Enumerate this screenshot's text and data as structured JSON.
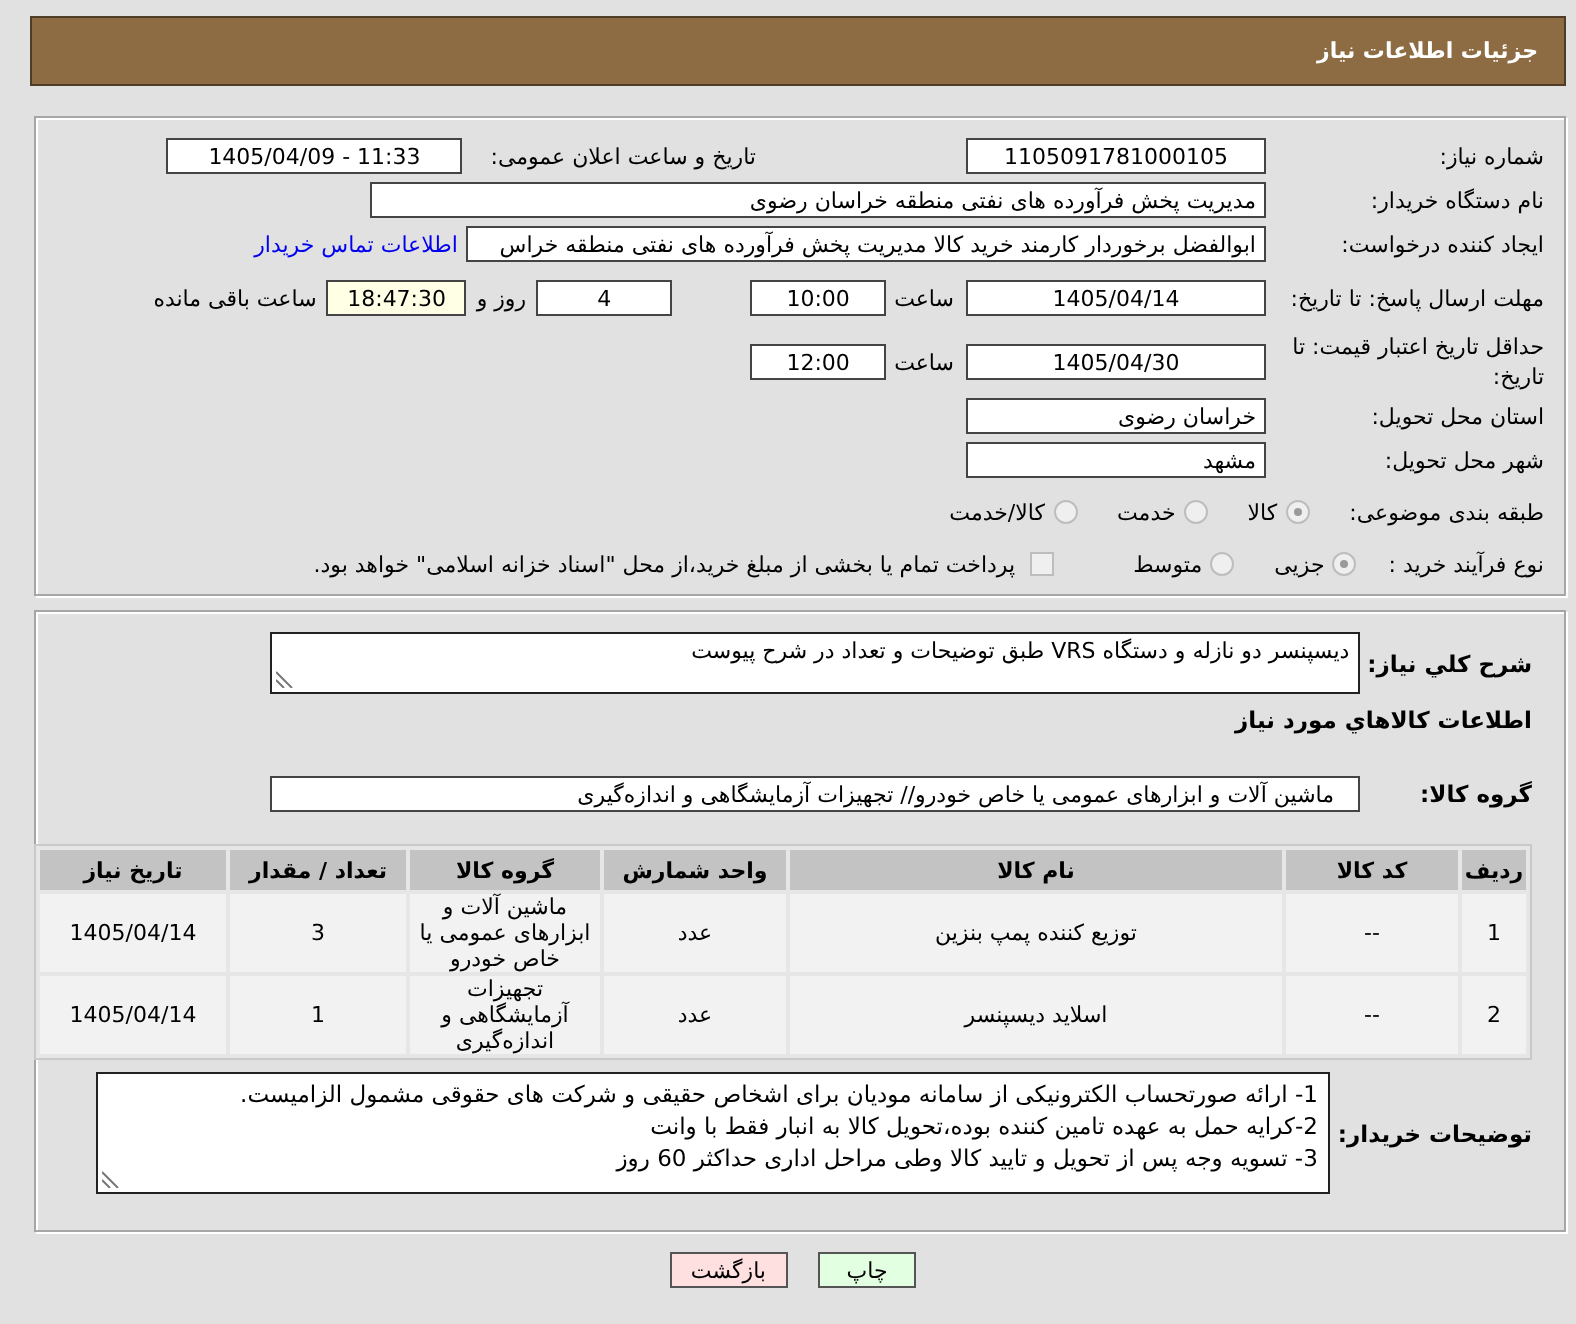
{
  "header": {
    "title": "جزئیات اطلاعات نیاز"
  },
  "details": {
    "need_number": {
      "label": "شماره نیاز:",
      "value": "1105091781000105"
    },
    "announce_datetime": {
      "label": "تاریخ و ساعت اعلان عمومی:",
      "value": "1405/04/09 - 11:33"
    },
    "buyer_org": {
      "label": "نام دستگاه خریدار:",
      "value": "مدیریت پخش فرآورده های نفتی منطقه خراسان رضوی"
    },
    "requester": {
      "label": "ایجاد کننده درخواست:",
      "value": "ابوالفضل برخوردار کارمند خرید کالا مدیریت پخش فرآورده های نفتی منطقه خراس",
      "contact_link": "اطلاعات تماس خریدار"
    },
    "reply_deadline": {
      "label": "مهلت ارسال پاسخ: تا تاریخ:",
      "date": "1405/04/14",
      "time_label": "ساعت",
      "time": "10:00",
      "days": "4",
      "days_label": "روز و",
      "remaining": "18:47:30",
      "remaining_label": "ساعت باقی مانده"
    },
    "price_validity": {
      "label": "حداقل تاریخ اعتبار قیمت: تا تاریخ:",
      "date": "1405/04/30",
      "time_label": "ساعت",
      "time": "12:00"
    },
    "delivery_province": {
      "label": "استان محل تحویل:",
      "value": "خراسان رضوی"
    },
    "delivery_city": {
      "label": "شهر محل تحویل:",
      "value": "مشهد"
    },
    "subject_category": {
      "label": "طبقه بندی موضوعی:",
      "options": [
        {
          "label": "کالا",
          "selected": true
        },
        {
          "label": "خدمت",
          "selected": false
        },
        {
          "label": "کالا/خدمت",
          "selected": false
        }
      ]
    },
    "purchase_process": {
      "label": "نوع فرآیند خرید :",
      "options": [
        {
          "label": "جزیی",
          "selected": true
        },
        {
          "label": "متوسط",
          "selected": false
        }
      ],
      "treasury_payment": {
        "label": "پرداخت تمام یا بخشی از مبلغ خرید،از محل \"اسناد خزانه اسلامی\" خواهد بود.",
        "checked": false
      }
    }
  },
  "description": {
    "label": "شرح کلي نياز:",
    "value": "دیسپنسر دو نازله و دستگاه VRS طبق توضیحات و تعداد در شرح پیوست"
  },
  "goods": {
    "title": "اطلاعات کالاهاي مورد نياز",
    "group": {
      "label": "گروه کالا:",
      "value": "ماشین آلات و ابزارهای عمومی یا خاص خودرو// تجهیزات آزمایشگاهی و اندازه‌گیری"
    },
    "table": {
      "columns": [
        "ردیف",
        "کد کالا",
        "نام کالا",
        "واحد شمارش",
        "گروه کالا",
        "تعداد / مقدار",
        "تاریخ نیاز"
      ],
      "rows": [
        [
          "1",
          "--",
          "توزیع کننده پمپ بنزین",
          "عدد",
          "ماشین آلات و ابزارهای عمومی یا خاص خودرو",
          "3",
          "1405/04/14"
        ],
        [
          "2",
          "--",
          "اسلاید دیسپنسر",
          "عدد",
          "تجهیزات آزمایشگاهی و اندازه‌گیری",
          "1",
          "1405/04/14"
        ]
      ]
    }
  },
  "buyer_notes": {
    "label": "توضیحات خریدار:",
    "lines": [
      "1- ارائه صورتحساب الکترونیکی از سامانه مودیان برای اشخاص حقیقی و شرکت های حقوقی مشمول الزامیست.",
      "2-کرایه حمل به عهده تامین کننده بوده،تحویل کالا به انبار فقط با وانت",
      "3- تسویه وجه پس از تحویل و تایید کالا وطی مراحل اداری حداکثر 60 روز"
    ]
  },
  "buttons": [
    {
      "label": "چاپ",
      "kind": "print"
    },
    {
      "label": "بازگشت",
      "kind": "back"
    }
  ]
}
